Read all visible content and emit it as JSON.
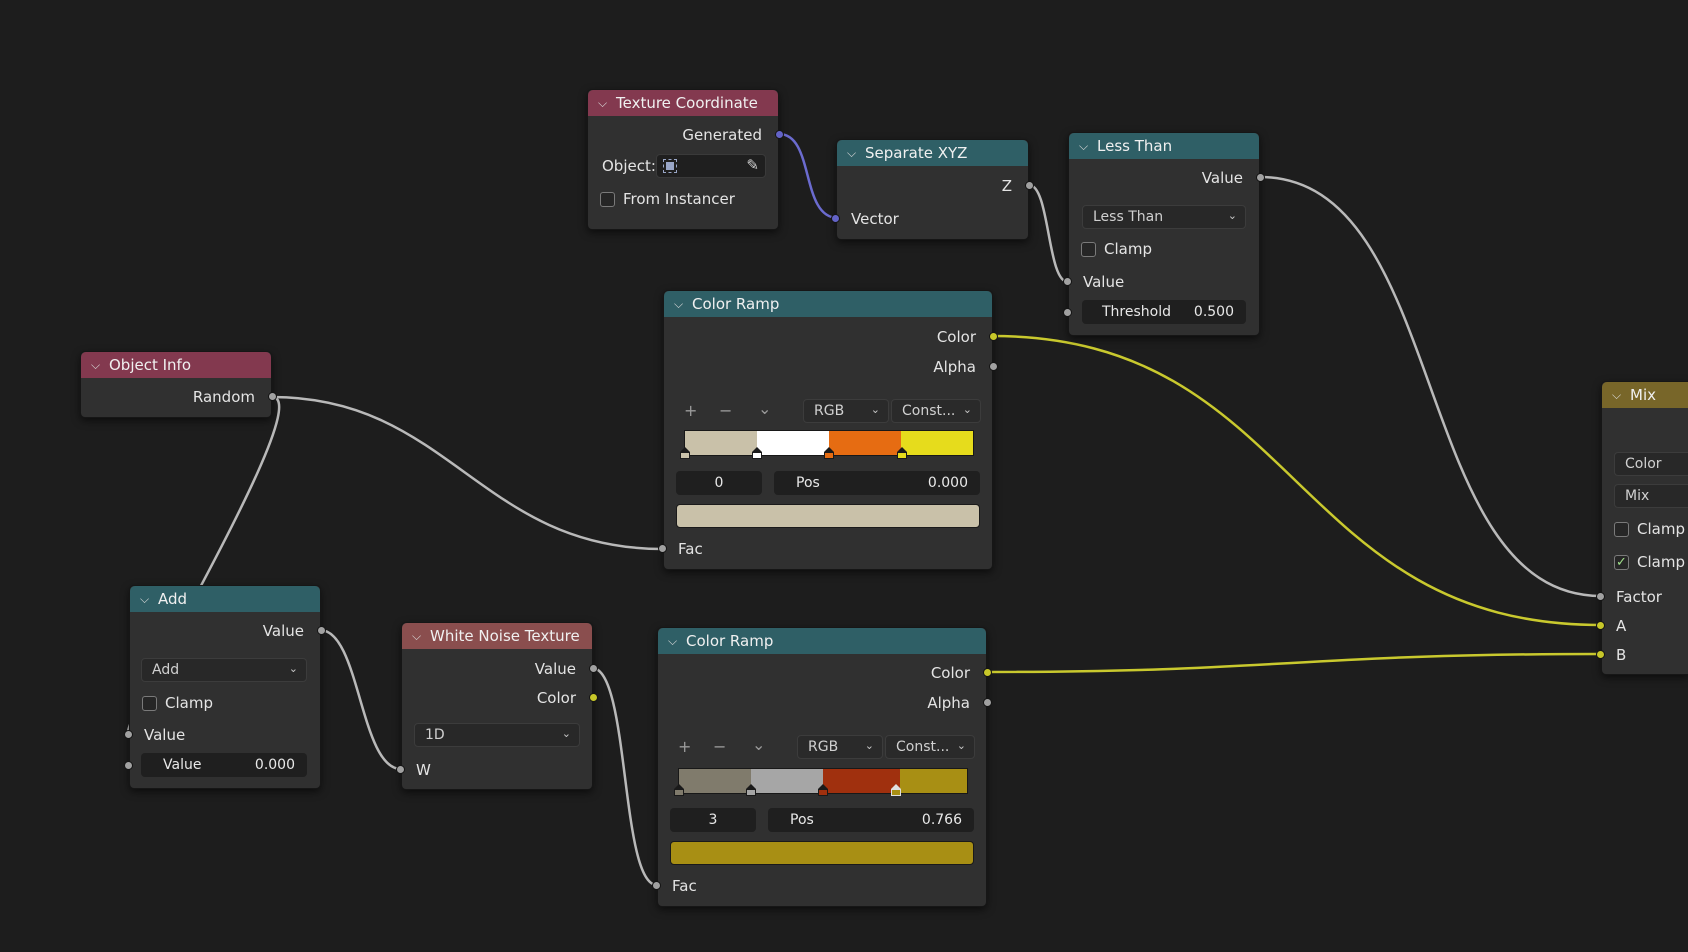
{
  "colors": {
    "background": "#1d1d1d",
    "node_body": "#303030",
    "header_input": "#83394f",
    "header_texture": "#8a4e4e",
    "header_converter": "#2f5f66",
    "header_color": "#786629",
    "socket_float": "#a1a1a1",
    "socket_color": "#c7c729",
    "socket_vector": "#6363c7",
    "wire_default": "#b9b9b9",
    "wire_color": "#c9c92e",
    "wire_vector": "#6b6bcf"
  },
  "nodes": {
    "texture_coordinate": {
      "title": "Texture Coordinate",
      "out_generated": "Generated",
      "object_label": "Object:",
      "from_instancer": "From Instancer"
    },
    "separate_xyz": {
      "title": "Separate XYZ",
      "out_z": "Z",
      "in_vector": "Vector"
    },
    "less_than": {
      "title": "Less Than",
      "out_value": "Value",
      "operation": "Less Than",
      "clamp": "Clamp",
      "in_value": "Value",
      "threshold_label": "Threshold",
      "threshold_value": "0.500"
    },
    "color_ramp_1": {
      "title": "Color Ramp",
      "out_color": "Color",
      "out_alpha": "Alpha",
      "tool_add": "+",
      "tool_remove": "−",
      "tool_menu": "⌄",
      "color_mode": "RGB",
      "interpolation": "Const...",
      "active_index": "0",
      "pos_label": "Pos",
      "pos_value": "0.000",
      "active_color": "#c9c1a9",
      "in_fac": "Fac",
      "stops": [
        {
          "pos": 0.0,
          "color": "#c9c1a9"
        },
        {
          "pos": 0.25,
          "color": "#ffffff"
        },
        {
          "pos": 0.5,
          "color": "#e66c12"
        },
        {
          "pos": 0.75,
          "color": "#e6dc1c"
        }
      ]
    },
    "color_ramp_2": {
      "title": "Color Ramp",
      "out_color": "Color",
      "out_alpha": "Alpha",
      "tool_add": "+",
      "tool_remove": "−",
      "tool_menu": "⌄",
      "color_mode": "RGB",
      "interpolation": "Const...",
      "active_index": "3",
      "pos_label": "Pos",
      "pos_value": "0.766",
      "active_color": "#a88f14",
      "in_fac": "Fac",
      "stops": [
        {
          "pos": 0.0,
          "color": "#807b6c"
        },
        {
          "pos": 0.25,
          "color": "#a6a6a6"
        },
        {
          "pos": 0.5,
          "color": "#a0300e"
        },
        {
          "pos": 0.766,
          "color": "#a88f14"
        }
      ]
    },
    "object_info": {
      "title": "Object Info",
      "out_random": "Random"
    },
    "add": {
      "title": "Add",
      "out_value": "Value",
      "operation": "Add",
      "clamp": "Clamp",
      "in_value": "Value",
      "value_label": "Value",
      "value_value": "0.000"
    },
    "white_noise": {
      "title": "White Noise Texture",
      "out_value": "Value",
      "out_color": "Color",
      "dimensions": "1D",
      "in_w": "W"
    },
    "mix": {
      "title": "Mix",
      "data_type": "Color",
      "blend_mode": "Mix",
      "clamp_result": "Clamp R",
      "clamp_factor": "Clamp F",
      "in_factor": "Factor",
      "in_a": "A",
      "in_b": "B"
    }
  }
}
